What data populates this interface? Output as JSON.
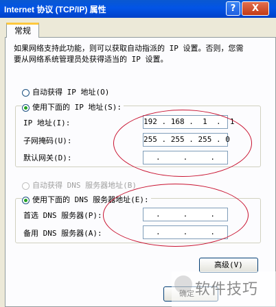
{
  "window": {
    "title": "Internet 协议 (TCP/IP) 属性",
    "help_glyph": "?",
    "close_glyph": "X"
  },
  "tabs": [
    {
      "label": "常规"
    }
  ],
  "description": "如果网络支持此功能，则可以获取自动指派的 IP 设置。否则，您需要从网络系统管理员处获得适当的 IP 设置。",
  "ip_section": {
    "auto_option": {
      "label": "自动获得 IP 地址(O)",
      "selected": false
    },
    "manual_option": {
      "label": "使用下面的 IP 地址(S):",
      "selected": true
    },
    "fields": [
      {
        "label": "IP 地址(I):",
        "value": "192 . 168 .  1  .  1"
      },
      {
        "label": "子网掩码(U):",
        "value": "255 . 255 . 255 . 0"
      },
      {
        "label": "默认网关(D):",
        "value": "  .     .     .  "
      }
    ]
  },
  "dns_section": {
    "auto_option": {
      "label": "自动获得 DNS 服务器地址(B)",
      "selected": false,
      "enabled": false
    },
    "manual_option": {
      "label": "使用下面的 DNS 服务器地址(E):",
      "selected": true
    },
    "fields": [
      {
        "label": "首选 DNS 服务器(P):",
        "value": "  .     .     .  "
      },
      {
        "label": "备用 DNS 服务器(A):",
        "value": "  .     .     .  "
      }
    ]
  },
  "buttons": {
    "advanced": "高级(V)",
    "ok": "确定"
  },
  "watermark": "软件技巧",
  "colors": {
    "titlebar": "#0254e6",
    "annotation": "#c8102e",
    "radio_selected": "#21a121"
  }
}
